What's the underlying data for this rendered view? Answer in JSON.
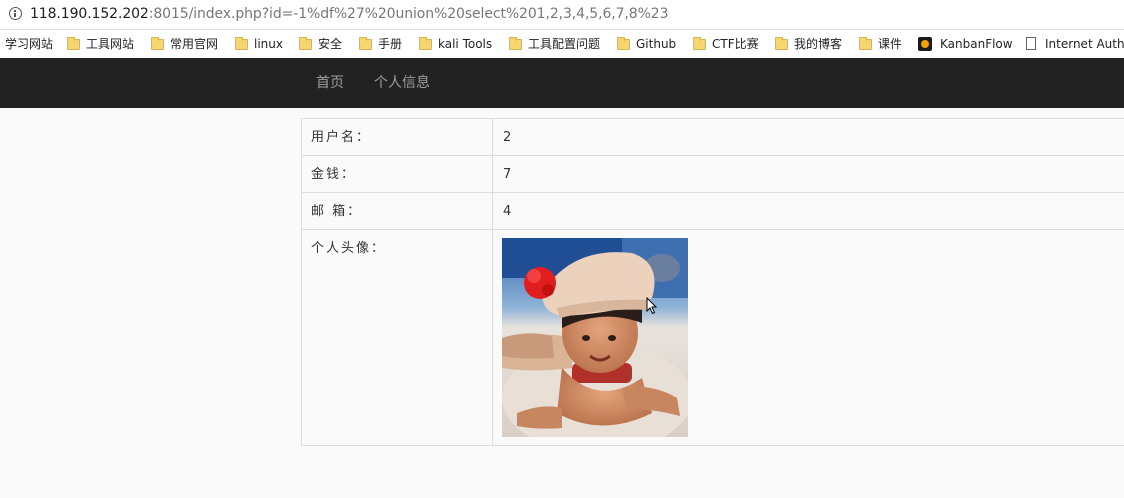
{
  "address_bar": {
    "url_host": "118.190.152.202",
    "url_rest": ":8015/index.php?id=-1%df%27%20union%20select%201,2,3,4,5,6,7,8%23"
  },
  "bookmarks": [
    {
      "label": "学习网站",
      "icon": "none"
    },
    {
      "label": "工具网站",
      "icon": "folder-icon"
    },
    {
      "label": "常用官网",
      "icon": "folder-icon"
    },
    {
      "label": "linux",
      "icon": "folder-icon"
    },
    {
      "label": "安全",
      "icon": "folder-icon"
    },
    {
      "label": "手册",
      "icon": "folder-icon"
    },
    {
      "label": "kali Tools",
      "icon": "folder-icon"
    },
    {
      "label": "工具配置问题",
      "icon": "folder-icon"
    },
    {
      "label": "Github",
      "icon": "folder-icon"
    },
    {
      "label": "CTF比赛",
      "icon": "folder-icon"
    },
    {
      "label": "我的博客",
      "icon": "folder-icon"
    },
    {
      "label": "课件",
      "icon": "folder-icon"
    },
    {
      "label": "KanbanFlow",
      "icon": "kanbanflow-icon"
    },
    {
      "label": "Internet Auth",
      "icon": "page-icon"
    }
  ],
  "navbar": {
    "home": "首页",
    "profile": "个人信息"
  },
  "profile": {
    "username_label": "用户名：",
    "username_value": "2",
    "money_label": "金钱：",
    "money_value": "7",
    "email_label": "邮 箱：",
    "email_value": "4",
    "avatar_label": "个人头像："
  },
  "colors": {
    "navbar_bg": "#222222",
    "nav_link": "#9d9d9d",
    "page_bg": "#fafafa",
    "border": "#dddddd"
  }
}
